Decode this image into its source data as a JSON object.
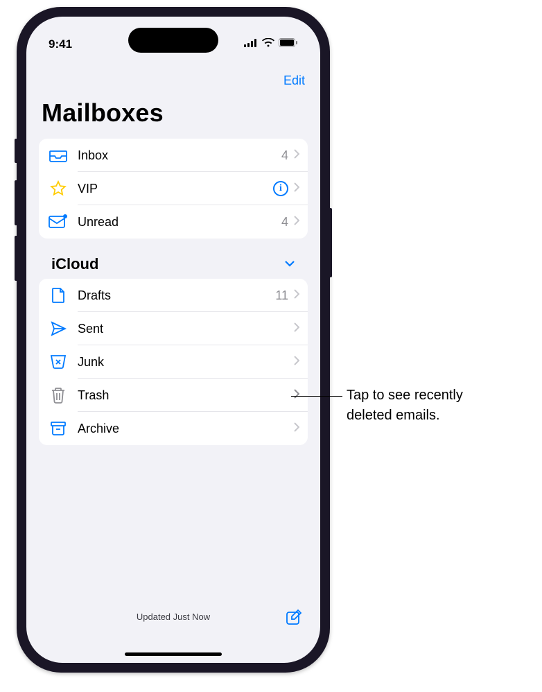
{
  "statusBar": {
    "time": "9:41"
  },
  "navBar": {
    "editLabel": "Edit"
  },
  "title": "Mailboxes",
  "smartMailboxes": {
    "items": [
      {
        "icon": "inbox-icon",
        "label": "Inbox",
        "count": "4",
        "hasCount": true,
        "hasInfo": false
      },
      {
        "icon": "star-icon",
        "label": "VIP",
        "count": "",
        "hasCount": false,
        "hasInfo": true
      },
      {
        "icon": "unread-icon",
        "label": "Unread",
        "count": "4",
        "hasCount": true,
        "hasInfo": false
      }
    ]
  },
  "account": {
    "header": "iCloud",
    "items": [
      {
        "icon": "drafts-icon",
        "label": "Drafts",
        "count": "11",
        "gray": false
      },
      {
        "icon": "sent-icon",
        "label": "Sent",
        "count": "",
        "gray": false
      },
      {
        "icon": "junk-icon",
        "label": "Junk",
        "count": "",
        "gray": false
      },
      {
        "icon": "trash-icon",
        "label": "Trash",
        "count": "",
        "gray": true
      },
      {
        "icon": "archive-icon",
        "label": "Archive",
        "count": "",
        "gray": false
      }
    ]
  },
  "bottomBar": {
    "status": "Updated Just Now"
  },
  "callout": {
    "line1": "Tap to see recently",
    "line2": "deleted emails."
  },
  "colors": {
    "tint": "#007aff",
    "star": "#ffcc00"
  }
}
